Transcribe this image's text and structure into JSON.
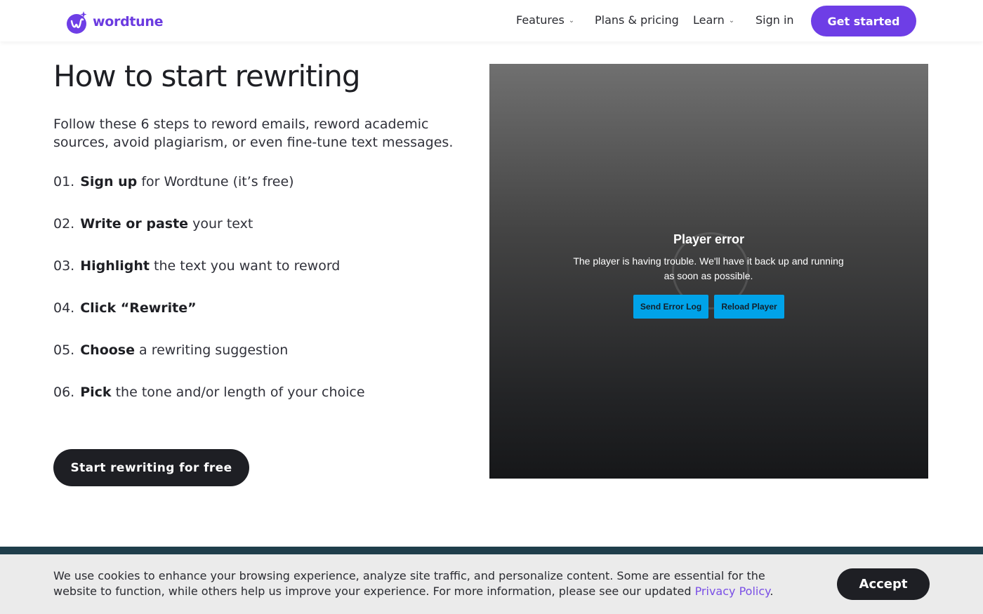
{
  "header": {
    "logo_text": "wordtune",
    "nav": [
      {
        "label": "Features",
        "has_dropdown": true
      },
      {
        "label": "Plans & pricing",
        "has_dropdown": false
      },
      {
        "label": "Learn",
        "has_dropdown": true
      },
      {
        "label": "Sign in",
        "has_dropdown": false
      }
    ],
    "cta_label": "Get started"
  },
  "main": {
    "title": "How to start rewriting",
    "intro": "Follow these 6 steps to reword emails, reword academic sources, avoid plagiarism, or even fine-tune text messages.",
    "steps": [
      {
        "num": "01.",
        "strong": "Sign up",
        "rest": " for Wordtune (it’s free)"
      },
      {
        "num": "02.",
        "strong": "Write or paste",
        "rest": " your text"
      },
      {
        "num": "03.",
        "strong": "Highlight",
        "rest": " the text you want to reword"
      },
      {
        "num": "04.",
        "strong": "Click “Rewrite”",
        "rest": ""
      },
      {
        "num": "05.",
        "strong": "Choose",
        "rest": " a rewriting suggestion"
      },
      {
        "num": "06.",
        "strong": "Pick",
        "rest": " the tone and/or length of your choice"
      }
    ],
    "cta_label": "Start rewriting for free"
  },
  "player": {
    "error_title": "Player error",
    "error_message": "The player is having trouble. We'll have it back up and running as soon as possible.",
    "send_log_label": "Send Error Log",
    "reload_label": "Reload Player"
  },
  "cookie": {
    "text": "We use cookies to enhance your browsing experience, analyze site traffic, and personalize content. Some are essential for the website to function, while others help us improve your experience. For more information, please see our updated ",
    "link_label": "Privacy Policy",
    "suffix": ".",
    "accept_label": "Accept"
  },
  "colors": {
    "brand_purple": "#6e3ee6",
    "dark": "#1e1f24",
    "player_button": "#00a3e9",
    "footer_band": "#1f3e4b",
    "cookie_bg": "#ebebeb"
  }
}
